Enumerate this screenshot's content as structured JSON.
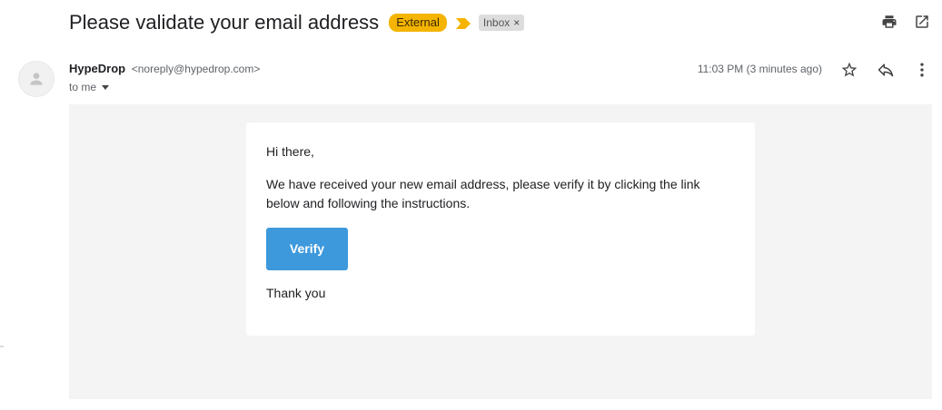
{
  "subject": "Please validate your email address",
  "labels": {
    "external": "External",
    "inbox": "Inbox",
    "inbox_remove": "×"
  },
  "sender": {
    "name": "HypeDrop",
    "email": "<noreply@hypedrop.com>",
    "recipient": "to me",
    "timestamp": "11:03 PM (3 minutes ago)"
  },
  "icons": {
    "print": "print-icon",
    "open_new_window": "open-in-new-window-icon",
    "star": "star-icon",
    "reply": "reply-icon",
    "more": "more-vert-icon",
    "avatar": "person-icon",
    "important": "important-marker-icon"
  },
  "email_body": {
    "greeting": "Hi there,",
    "message": "We have received your new email address, please verify it by clicking the link below and following the instructions.",
    "button_label": "Verify",
    "closing": "Thank you"
  },
  "colors": {
    "external_label": "#f4b400",
    "important_marker": "#f4b400",
    "inbox_label": "#dddddd",
    "verify_button": "#3d99dc",
    "body_background": "#f4f4f4"
  }
}
